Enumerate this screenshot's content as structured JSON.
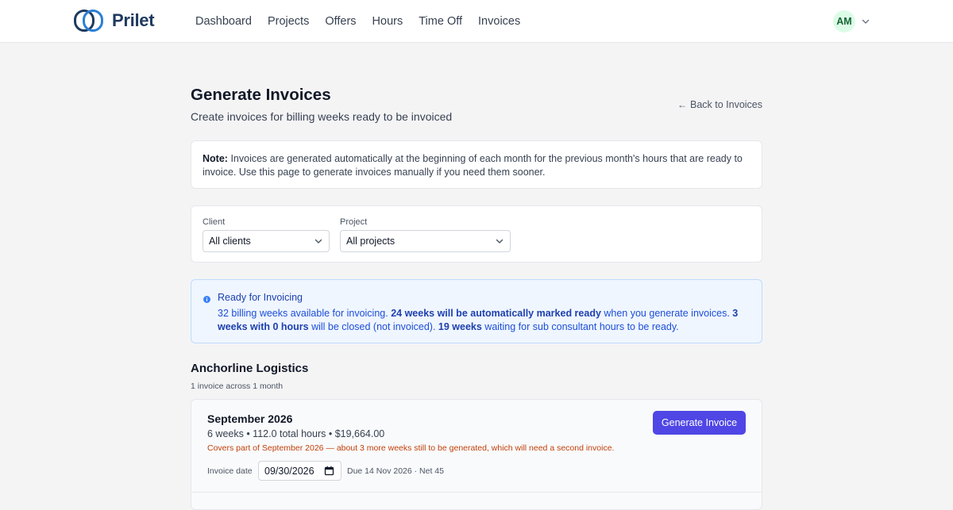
{
  "app": {
    "brand": "Prilet"
  },
  "nav": {
    "items": [
      {
        "label": "Dashboard"
      },
      {
        "label": "Projects"
      },
      {
        "label": "Offers"
      },
      {
        "label": "Hours"
      },
      {
        "label": "Time Off"
      },
      {
        "label": "Invoices"
      }
    ]
  },
  "user": {
    "initials": "AM"
  },
  "page": {
    "title": "Generate Invoices",
    "subtitle": "Create invoices for billing weeks ready to be invoiced",
    "back_link": "Back to Invoices"
  },
  "note": {
    "label": "Note:",
    "text": "Invoices are generated automatically at the beginning of each month for the previous month's hours that are ready to invoice. Use this page to generate invoices manually if you need them sooner."
  },
  "filters": {
    "client": {
      "label": "Client",
      "value": "All clients"
    },
    "project": {
      "label": "Project",
      "value": "All projects"
    }
  },
  "info": {
    "title": "Ready for Invoicing",
    "part1": "32 billing weeks available for invoicing. ",
    "bold1": "24 weeks will be automatically marked ready",
    "part2": " when you generate invoices. ",
    "bold2": "3 weeks with 0 hours",
    "part3": " will be closed (not invoiced). ",
    "bold3": "19 weeks",
    "part4": " waiting for sub consultant hours to be ready."
  },
  "client_section": {
    "name": "Anchorline Logistics",
    "count": "1 invoice across 1 month",
    "invoice": {
      "month": "September 2026",
      "meta": "6 weeks • 112.0 total hours • $19,664.00",
      "warning": "Covers part of September 2026 — about 3 more weeks still to be generated, which will need a second invoice.",
      "button": "Generate Invoice",
      "date_label": "Invoice date",
      "date_value": "09/30/2026",
      "due": "Due 14 Nov 2026 · Net 45"
    }
  },
  "colors": {
    "primary": "#4f46e5",
    "info_bg": "#eff6ff",
    "info_text": "#1d4ed8",
    "warning": "#c2410c",
    "brand": "#1e3a5f",
    "avatar_bg": "#dcfce7"
  }
}
